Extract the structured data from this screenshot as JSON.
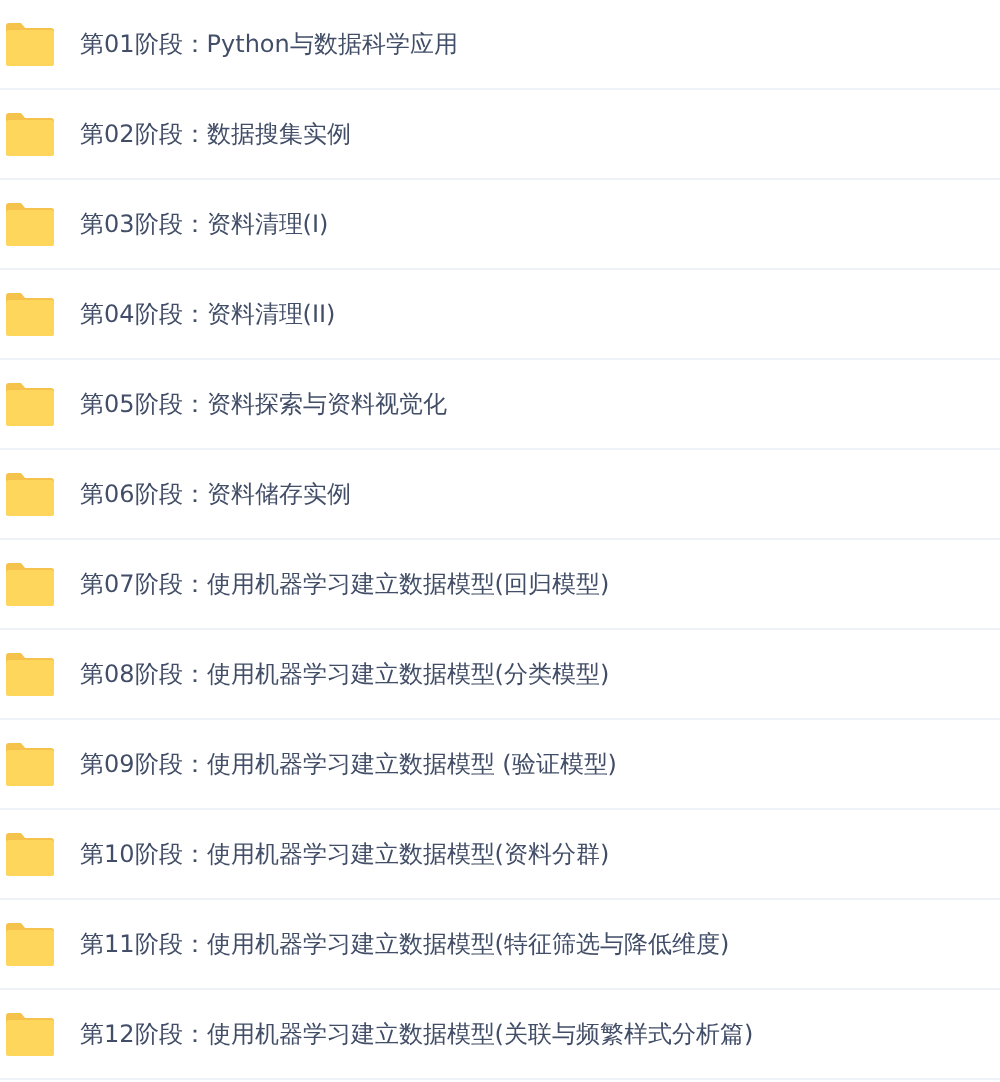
{
  "folders": [
    {
      "name": "第01阶段：Python与数据科学应用"
    },
    {
      "name": "第02阶段：数据搜集实例"
    },
    {
      "name": "第03阶段：资料清理(I)"
    },
    {
      "name": "第04阶段：资料清理(II)"
    },
    {
      "name": "第05阶段：资料探索与资料视觉化"
    },
    {
      "name": "第06阶段：资料储存实例"
    },
    {
      "name": "第07阶段：使用机器学习建立数据模型(回归模型)"
    },
    {
      "name": "第08阶段：使用机器学习建立数据模型(分类模型)"
    },
    {
      "name": "第09阶段：使用机器学习建立数据模型 (验证模型)"
    },
    {
      "name": "第10阶段：使用机器学习建立数据模型(资料分群)"
    },
    {
      "name": "第11阶段：使用机器学习建立数据模型(特征筛选与降低维度)"
    },
    {
      "name": "第12阶段：使用机器学习建立数据模型(关联与频繁样式分析篇)"
    }
  ]
}
